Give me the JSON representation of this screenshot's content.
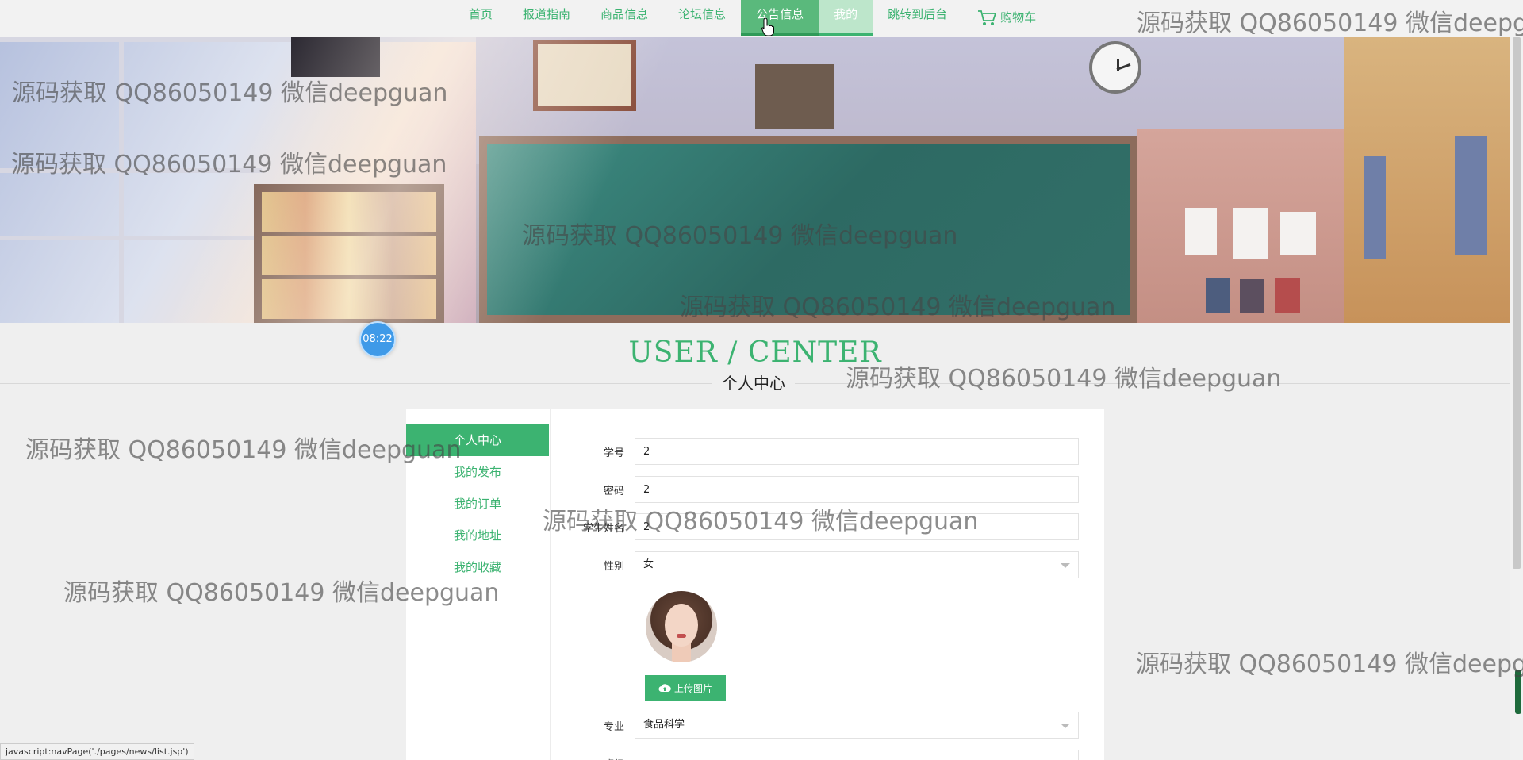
{
  "nav": {
    "items": [
      {
        "label": "首页"
      },
      {
        "label": "报道指南"
      },
      {
        "label": "商品信息"
      },
      {
        "label": "论坛信息"
      },
      {
        "label": "公告信息"
      },
      {
        "label": "我的"
      },
      {
        "label": "跳转到后台"
      }
    ],
    "cart_label": "购物车",
    "cart_icon": "cart-icon",
    "hovered_index": 4,
    "active_index": 5
  },
  "timer": "08:22",
  "section": {
    "title_en": "USER / CENTER",
    "title_cn": "个人中心"
  },
  "side_menu": [
    {
      "label": "个人中心",
      "active": true
    },
    {
      "label": "我的发布"
    },
    {
      "label": "我的订单"
    },
    {
      "label": "我的地址"
    },
    {
      "label": "我的收藏"
    }
  ],
  "form": {
    "student_id": {
      "label": "学号",
      "value": "2"
    },
    "password": {
      "label": "密码",
      "value": "2"
    },
    "student_name": {
      "label": "学生姓名",
      "value": "2"
    },
    "gender": {
      "label": "性别",
      "value": "女"
    },
    "upload_label": "上传图片",
    "upload_icon": "cloud-upload-icon",
    "major": {
      "label": "专业",
      "value": "食品科学"
    },
    "next_label": "班级",
    "next_value": "..."
  },
  "status_bar": "javascript:navPage('./pages/news/list.jsp')",
  "watermark": "源码获取 QQ86050149 微信deepguan",
  "colors": {
    "accent": "#3cb371",
    "nav_hover": "#5ab97c",
    "nav_active": "#bde6cb",
    "timer_bg": "#3f9ae8"
  }
}
